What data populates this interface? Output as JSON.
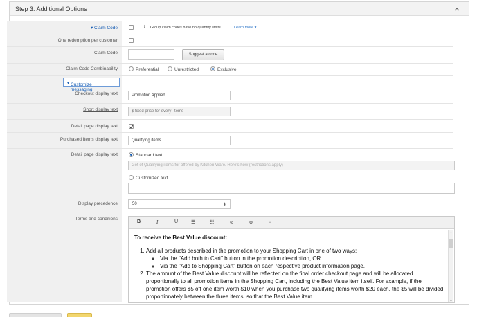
{
  "panel": {
    "title": "Step 3: Additional Options"
  },
  "claim_code_toggle": {
    "label": "Claim Code",
    "note": "Group claim codes have no quantity limits.",
    "learn_more": "Learn more"
  },
  "one_redemption": {
    "label": "One redemption per customer"
  },
  "claim_code": {
    "label": "Claim Code",
    "value": "",
    "suggest_label": "Suggest a code"
  },
  "combinability": {
    "label": "Claim Code Combinability",
    "options": [
      "Preferential",
      "Unrestricted",
      "Exclusive"
    ],
    "selected": "Exclusive"
  },
  "customize": {
    "label": "Customize messaging"
  },
  "checkout_display": {
    "label": "Checkout display text",
    "value": "Promotion Applied"
  },
  "short_display": {
    "label": "Short display text",
    "placeholder": "$ fixed price for every  items"
  },
  "detail_page_text": {
    "label": "Detail page display text"
  },
  "purchased_items": {
    "label": "Purchased Items display text",
    "value": "Qualifying items"
  },
  "detail_page_display": {
    "label": "Detail page display text",
    "standard_label": "Standard text",
    "standard_value": "Get of Qualifying items for offered by Kitchen Ware. Here's how (restrictions apply)",
    "custom_label": "Customized text",
    "custom_value": ""
  },
  "display_precedence": {
    "label": "Display precedence",
    "value": "50"
  },
  "terms": {
    "label": "Terms and conditions",
    "toolbar": [
      "B",
      "I",
      "U",
      "ordered-list",
      "unordered-list",
      "link",
      "unlink",
      "code"
    ],
    "heading": "To receive the Best Value discount:",
    "item1": "Add all products described in the promotion to your Shopping Cart in one of two ways:",
    "item1_sub1": "Via the   \"Add both to Cart\"   button in the promotion description, OR",
    "item1_sub2": "Via the   \"Add to Shopping Cart\"   button on each respective product information page.",
    "item2": "The amount of the Best Value discount will be reflected on the final order checkout page and will be allocated proportionally to all promotion items in the Shopping Cart, including the Best Value item itself. For example, if the promotion offers $5 off one item worth $10 when you purchase two qualifying items worth $20 each, the $5 will be divided proportionately between the three items, so that the Best Value item"
  },
  "colors": {
    "link": "#2e76c8",
    "radio_selected": "#1a5fb4",
    "label_bg": "#f0f0f0"
  }
}
